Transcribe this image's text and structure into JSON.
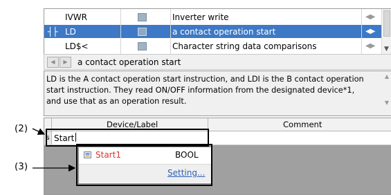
{
  "instruction_list": [
    {
      "mnemonic": "IVWR",
      "description": "Inverter write",
      "selected": false,
      "coil": ""
    },
    {
      "mnemonic": "LD",
      "description": "a contact operation start",
      "selected": true,
      "coil": "┤├"
    },
    {
      "mnemonic": "LD$<",
      "description": "Character string data comparisons",
      "selected": false,
      "coil": ""
    }
  ],
  "nav": {
    "text": "a contact operation start"
  },
  "description": {
    "text": "LD is the A contact operation start instruction, and LDI is the B contact operation start instruction. They read ON/OFF information from the designated device*1, and use that as an operation result."
  },
  "table": {
    "header_device": "Device/Label",
    "header_comment": "Comment",
    "row_marker": "s",
    "input_value": "Start"
  },
  "popup": {
    "item_name": "Start1",
    "item_type": "BOOL",
    "setting_link": "Setting..."
  },
  "callouts": {
    "c2": "(2)",
    "c3": "(3)"
  },
  "colors": {
    "selection": "#3d79c6",
    "label_red": "#d6372b",
    "link_blue": "#2a5fb4"
  }
}
